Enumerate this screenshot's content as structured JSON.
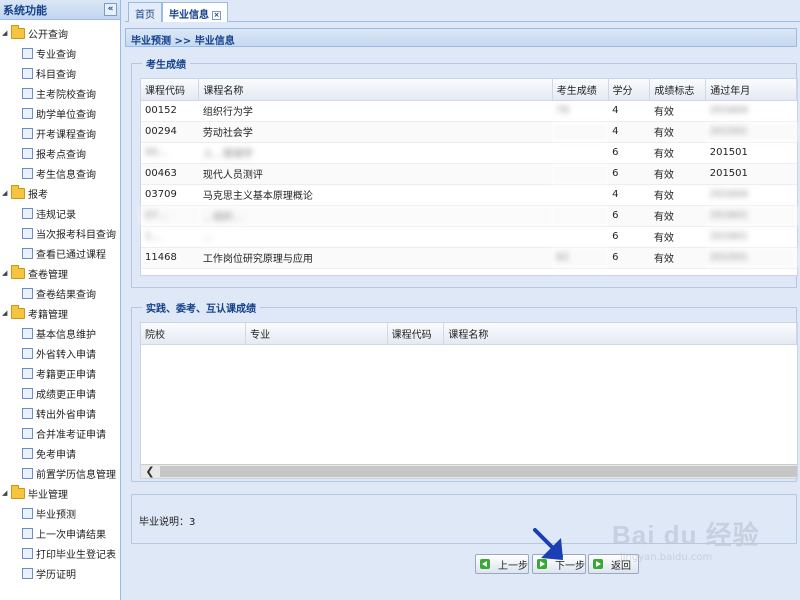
{
  "sidebar": {
    "title": "系统功能",
    "collapse_icon": "«",
    "groups": [
      {
        "label": "公开查询",
        "items": [
          "专业查询",
          "科目查询",
          "主考院校查询",
          "助学单位查询",
          "开考课程查询",
          "报考点查询",
          "考生信息查询"
        ]
      },
      {
        "label": "报考",
        "items": [
          "违规记录",
          "当次报考科目查询",
          "查看已通过课程"
        ]
      },
      {
        "label": "查卷管理",
        "items": [
          "查卷结果查询"
        ]
      },
      {
        "label": "考籍管理",
        "items": [
          "基本信息维护",
          "外省转入申请",
          "考籍更正申请",
          "成绩更正申请",
          "转出外省申请",
          "合并准考证申请",
          "免考申请",
          "前置学历信息管理"
        ]
      },
      {
        "label": "毕业管理",
        "items": [
          "毕业预测",
          "上一次申请结果",
          "打印毕业生登记表",
          "学历证明"
        ]
      }
    ]
  },
  "tabs": [
    {
      "label": "首页"
    },
    {
      "label": "毕业信息",
      "close": "×"
    }
  ],
  "breadcrumb": "毕业预测 >> 毕业信息",
  "scores": {
    "legend": "考生成绩",
    "headers": [
      "课程代码",
      "课程名称",
      "考生成绩",
      "学分",
      "成绩标志",
      "通过年月"
    ],
    "rows": [
      [
        "00152",
        "组织行为学",
        "76",
        "4",
        "有效",
        "201604"
      ],
      [
        "00294",
        "劳动社会学",
        "",
        "4",
        "有效",
        "201501"
      ],
      [
        "00…",
        "人…管理学",
        "",
        "6",
        "有效",
        "201501"
      ],
      [
        "00463",
        "现代人员测评",
        "",
        "6",
        "有效",
        "201501"
      ],
      [
        "03709",
        "马克思主义基本原理概论",
        "",
        "4",
        "有效",
        "201604"
      ],
      [
        "07…",
        "…组织…",
        "",
        "6",
        "有效",
        "201601"
      ],
      [
        "1…",
        "…",
        "",
        "6",
        "有效",
        "201601"
      ],
      [
        "11468",
        "工作岗位研究原理与应用",
        "62",
        "6",
        "有效",
        "201501"
      ]
    ]
  },
  "practice": {
    "legend": "实践、委考、互认课成绩",
    "headers": [
      "院校",
      "专业",
      "课程代码",
      "课程名称"
    ],
    "scroll_left": "❮"
  },
  "note": "毕业说明：3",
  "buttons": {
    "prev": "上一步",
    "next": "下一步",
    "back": "返回"
  },
  "watermark": {
    "logo": "Bai du 经验",
    "url": "jingyan.baidu.com"
  },
  "colors": {
    "accent": "#15428b",
    "pointer": "#1a3fb5"
  }
}
